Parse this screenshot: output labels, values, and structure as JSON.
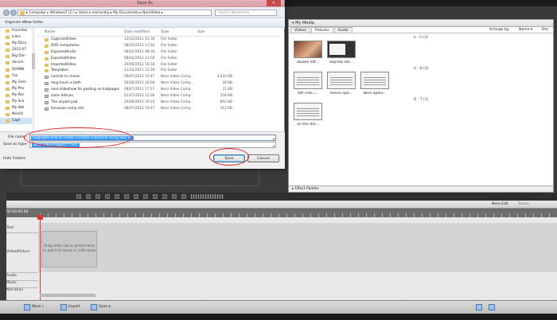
{
  "dialog": {
    "title": "Save As",
    "address_path": "▸ Computer ▸ Windows7 (C:) ▸ Users ▸ mariandiy ▸ My Documents ▸ NeroVideo ▸",
    "search_placeholder": "Search NeroVideo",
    "organize_label": "Organize ▾",
    "new_folder_label": "New folder",
    "nav_items": [
      {
        "label": "Favorites"
      },
      {
        "label": "Links"
      },
      {
        "label": "My Docu"
      },
      {
        "label": "2012-07"
      },
      {
        "label": "Big Dan"
      },
      {
        "label": "docum"
      },
      {
        "label": "DOWNI"
      },
      {
        "label": "Fax"
      },
      {
        "label": "My Gam"
      },
      {
        "label": "My Pho"
      },
      {
        "label": "My Rec"
      },
      {
        "label": "My Sca"
      },
      {
        "label": "My Wel"
      },
      {
        "label": "NeroVi"
      },
      {
        "label": "Capt"
      }
    ],
    "columns": {
      "name": "Name",
      "date": "Date modified",
      "type": "Type",
      "size": "Size"
    },
    "files": [
      {
        "name": "CapturedVideo",
        "date": "11/12/2011 12:36",
        "type": "File folder",
        "size": "",
        "kind": "folder"
      },
      {
        "name": "DVD compilation",
        "date": "08/02/2012 17:02",
        "type": "File folder",
        "size": "",
        "kind": "folder"
      },
      {
        "name": "ExportedAudio",
        "date": "08/02/2012 08:34",
        "type": "File folder",
        "size": "",
        "kind": "folder"
      },
      {
        "name": "ExportedVideo",
        "date": "08/02/2012 11:04",
        "type": "File folder",
        "size": "",
        "kind": "folder"
      },
      {
        "name": "ImportedVideo",
        "date": "20/06/2012 16:18",
        "type": "File folder",
        "size": "",
        "kind": "folder"
      },
      {
        "name": "Templates",
        "date": "11/12/2011 12:36",
        "type": "File folder",
        "size": "",
        "kind": "folder"
      },
      {
        "name": "cornish lin mines",
        "date": "06/07/2012 10:47",
        "type": "Nero Video Comp...",
        "size": "3,010 KB",
        "kind": "project"
      },
      {
        "name": "meg havin a bath",
        "date": "06/06/2012 20:04",
        "type": "Nero Video Comp...",
        "size": "28 KB",
        "kind": "project"
      },
      {
        "name": "nero slideshow for posting on hubpages",
        "date": "08/07/2012 17:27",
        "type": "Nero Video Comp...",
        "size": "21 KB",
        "kind": "project"
      },
      {
        "name": "sams 4dscan",
        "date": "01/07/2012 12:04",
        "type": "Nero Video Comp...",
        "size": "258 KB",
        "kind": "project"
      },
      {
        "name": "The airport pub",
        "date": "20/06/2012 20:24",
        "type": "Nero Video Comp...",
        "size": "892 KB",
        "kind": "project"
      },
      {
        "name": "trevaylor camp site",
        "date": "08/07/2012 19:47",
        "type": "Nero Video Comp...",
        "size": "312 KB",
        "kind": "project"
      }
    ],
    "file_name_label": "File name:",
    "file_name_value": "hubpages how to create a simple slideshow using nero 11",
    "save_type_label": "Save as type:",
    "save_type_value": "Nero Video Project (*.nvc)",
    "hide_folders_label": "Hide Folders",
    "save_label": "Save",
    "cancel_label": "Cancel",
    "close_label": "✕"
  },
  "media": {
    "title": "▾ My Media",
    "tabs": [
      {
        "label": "Videos"
      },
      {
        "label": "Pictures"
      },
      {
        "label": "Audio"
      }
    ],
    "arrange_label": "Arrange by:",
    "arrange_value": "Name ▾",
    "sort_value": "Sho",
    "groups": [
      {
        "header": "A - G (2)",
        "items": [
          {
            "label": "double left..."
          },
          {
            "label": "express edi..."
          }
        ]
      },
      {
        "header": "H - N (3)",
        "items": [
          {
            "label": "left click i..."
          },
          {
            "label": "movie opti..."
          },
          {
            "label": "Nero openi..."
          }
        ]
      },
      {
        "header": "O - T (1)",
        "items": [
          {
            "label": "on the dro..."
          }
        ]
      }
    ],
    "effect_label": "▸ Effect Palette"
  },
  "timeline": {
    "time": "00:00:00:00",
    "tracks": [
      {
        "label": "Text"
      },
      {
        "label": "Video/Picture"
      },
      {
        "label": "Audio"
      },
      {
        "label": "Music"
      },
      {
        "label": "Narration"
      }
    ],
    "drop_hint": "Drag video clip or picture here to add it to movie or slide show",
    "nero_edit": "Nero Edit",
    "tclean": "Tclean"
  },
  "bottom": {
    "more_label": "More »",
    "export_label": "Export",
    "save_label": "Save ▾"
  }
}
